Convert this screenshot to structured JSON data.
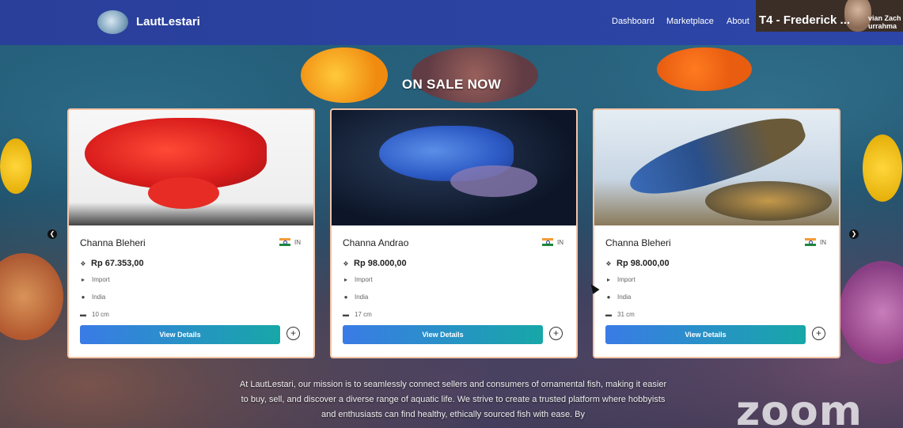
{
  "app": {
    "brand": "LautLestari"
  },
  "nav": {
    "links": [
      "Dashboard",
      "Marketplace",
      "About"
    ]
  },
  "video": {
    "label": "T4 - Frederick ...",
    "name_partial": "vian Zach\nurrahma"
  },
  "section": {
    "title": "ON SALE NOW"
  },
  "cards": [
    {
      "name": "Channa Bleheri",
      "country_code": "IN",
      "price": "Rp 67.353,00",
      "type": "Import",
      "origin": "India",
      "size": "10 cm",
      "button": "View Details",
      "image_colors": [
        "#f23a2a",
        "#b01818",
        "#f7f7f7"
      ]
    },
    {
      "name": "Channa Andrao",
      "country_code": "IN",
      "price": "Rp 98.000,00",
      "type": "Import",
      "origin": "India",
      "size": "17 cm",
      "button": "View Details",
      "image_colors": [
        "#3a6fd6",
        "#1a2f5c",
        "#0e1a33"
      ]
    },
    {
      "name": "Channa Bleheri",
      "country_code": "IN",
      "price": "Rp 98.000,00",
      "type": "Import",
      "origin": "India",
      "size": "31 cm",
      "button": "View Details",
      "image_colors": [
        "#4a7bc7",
        "#c9963a",
        "#dfe7ef"
      ]
    }
  ],
  "carousel": {
    "prev_icon": "chevron-left-icon",
    "next_icon": "chevron-right-icon"
  },
  "mission": {
    "text": "At LautLestari, our mission is to seamlessly connect sellers and consumers of ornamental fish, making it easier to buy, sell, and discover a diverse range of aquatic life. We strive to create a trusted platform where hobbyists and enthusiasts can find healthy, ethically sourced fish with ease. By"
  },
  "overlay": {
    "zoom_text": "zoom"
  },
  "colors": {
    "nav_bg": "#2c46a8",
    "accent_start": "#3a7be6",
    "accent_end": "#17a7a8",
    "card_border": "#f3c4a6"
  }
}
